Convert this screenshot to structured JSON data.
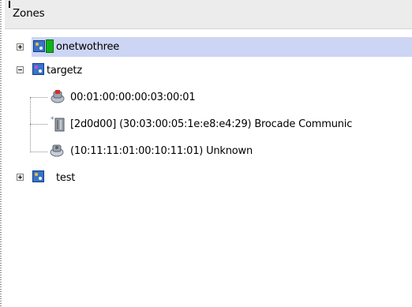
{
  "panel": {
    "title": "Zones"
  },
  "tree": {
    "zones": [
      {
        "label": "onetwothree",
        "expanded": false,
        "selected": true,
        "status_color": "#12b21c"
      },
      {
        "label": "targetz",
        "expanded": true,
        "members": [
          {
            "label": "00:01:00:00:00:03:00:01",
            "icon": "host-bus-adapter-icon"
          },
          {
            "label": "[2d0d00]  (30:03:00:05:1e:e8:e4:29) Brocade Communic",
            "icon": "storage-device-icon"
          },
          {
            "label": "(10:11:11:01:00:10:11:01) Unknown",
            "icon": "unknown-device-icon"
          }
        ]
      },
      {
        "label": "test",
        "expanded": false
      }
    ]
  },
  "colors": {
    "selection": "#cdd5f4",
    "header": "#ececec",
    "zone_icon": "#3a74c4"
  }
}
